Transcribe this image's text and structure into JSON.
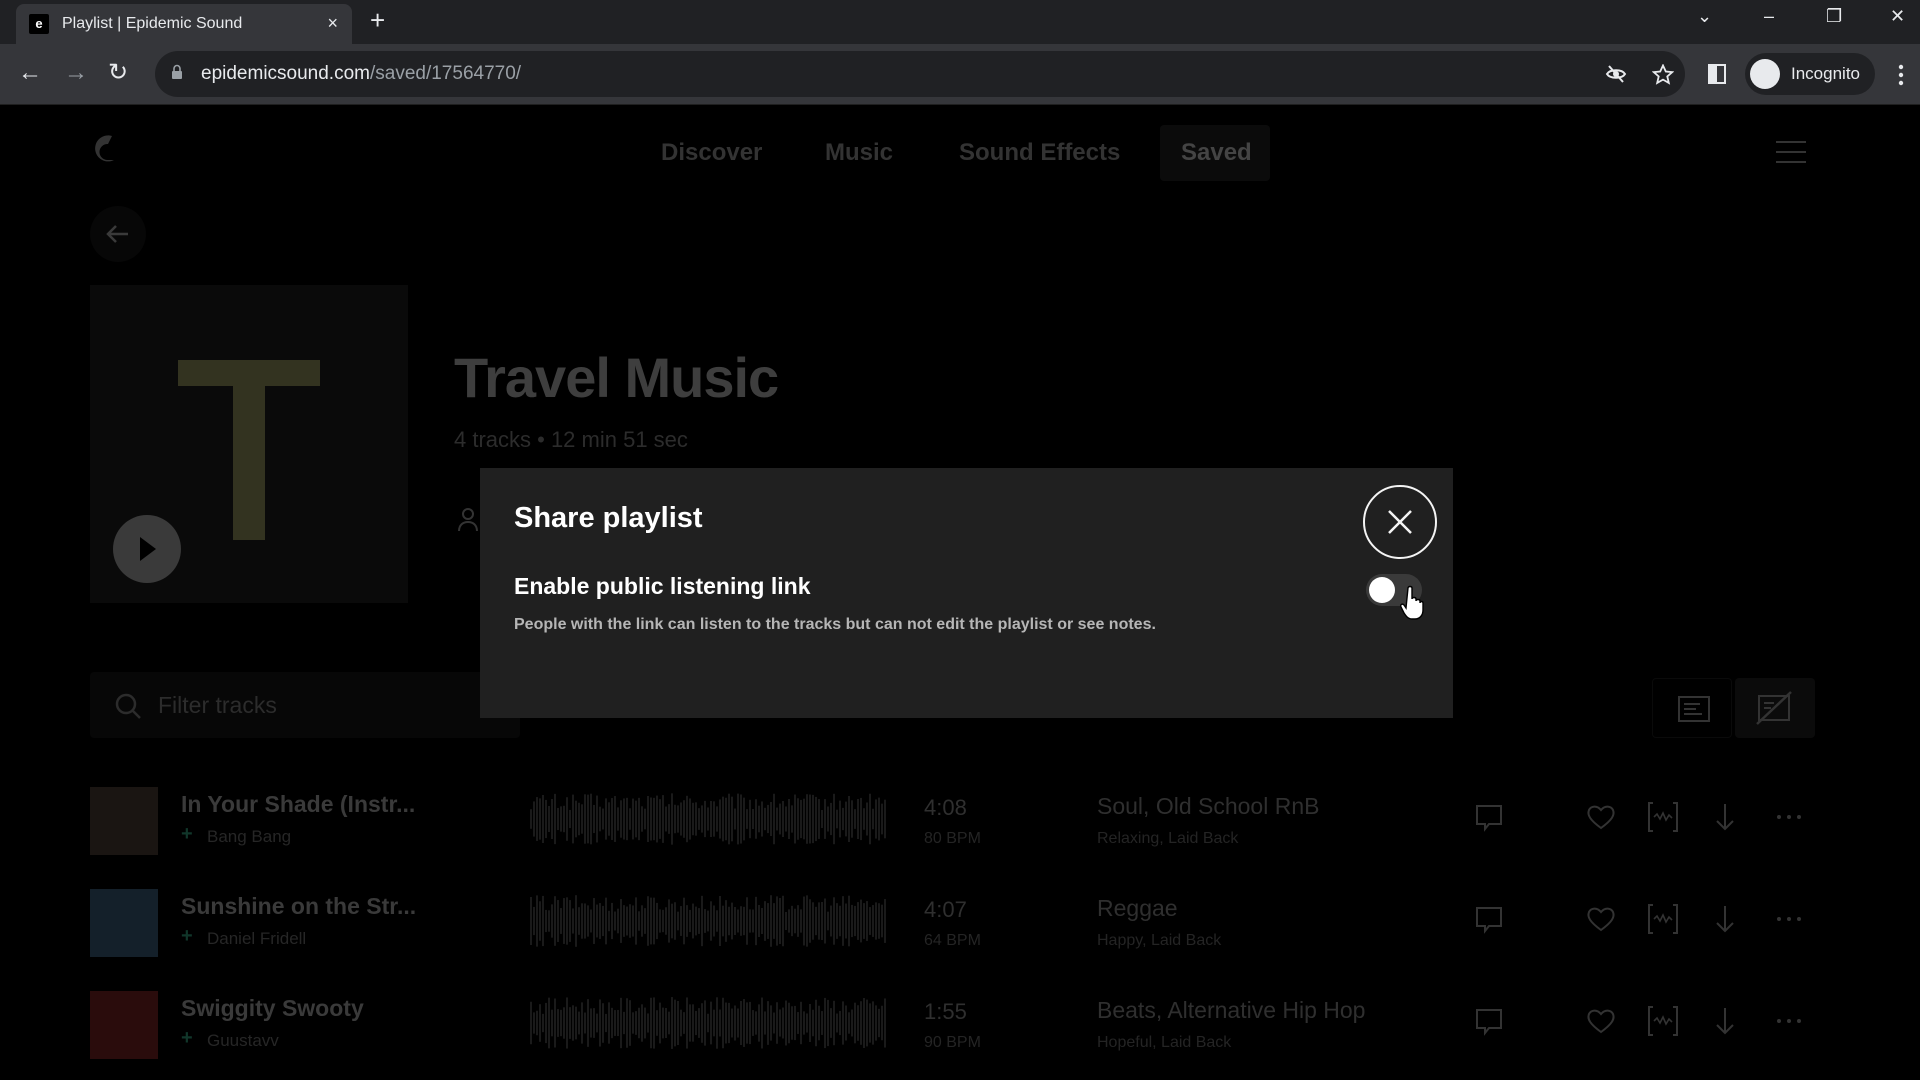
{
  "browser": {
    "tab_title": "Playlist | Epidemic Sound",
    "favicon_letter": "e",
    "new_tab": "+",
    "tab_close": "×",
    "url_host": "epidemicsound.com",
    "url_path": "/saved/17564770/",
    "profile_label": "Incognito",
    "window_controls": {
      "tab_search": "⌄",
      "minimize": "–",
      "restore": "❐",
      "close": "✕"
    },
    "nav": {
      "back": "←",
      "forward": "→",
      "reload": "↻"
    }
  },
  "site": {
    "nav": [
      {
        "label": "Discover",
        "active": false
      },
      {
        "label": "Music",
        "active": false
      },
      {
        "label": "Sound Effects",
        "active": false
      },
      {
        "label": "Saved",
        "active": true
      }
    ],
    "back_arrow": "←"
  },
  "playlist": {
    "cover_letter": "T",
    "title": "Travel Music",
    "meta": "4 tracks • 12 min 51 sec",
    "filter_placeholder": "Filter tracks"
  },
  "tracks": [
    {
      "title": "In Your Shade (Instr...",
      "artist": "Bang Bang",
      "duration": "4:08",
      "bpm": "80 BPM",
      "genres": "Soul, Old School RnB",
      "moods": "Relaxing, Laid Back",
      "thumb_color": "#1a1512"
    },
    {
      "title": "Sunshine on the Str...",
      "artist": "Daniel Fridell",
      "duration": "4:07",
      "bpm": "64 BPM",
      "genres": "Reggae",
      "moods": "Happy, Laid Back",
      "thumb_color": "#14202a"
    },
    {
      "title": "Swiggity Swooty",
      "artist": "Guustavv",
      "duration": "1:55",
      "bpm": "90 BPM",
      "genres": "Beats, Alternative Hip Hop",
      "moods": "Hopeful, Laid Back",
      "thumb_color": "#2a0c0c"
    }
  ],
  "modal": {
    "title": "Share playlist",
    "toggle_label": "Enable public listening link",
    "toggle_enabled": false,
    "description": "People with the link can listen to the tracks but can not edit the playlist or see notes.",
    "close_icon": "close-icon"
  },
  "colors": {
    "modal_bg": "#202020",
    "backdrop": "#000000",
    "accent_plus": "#11362a"
  }
}
